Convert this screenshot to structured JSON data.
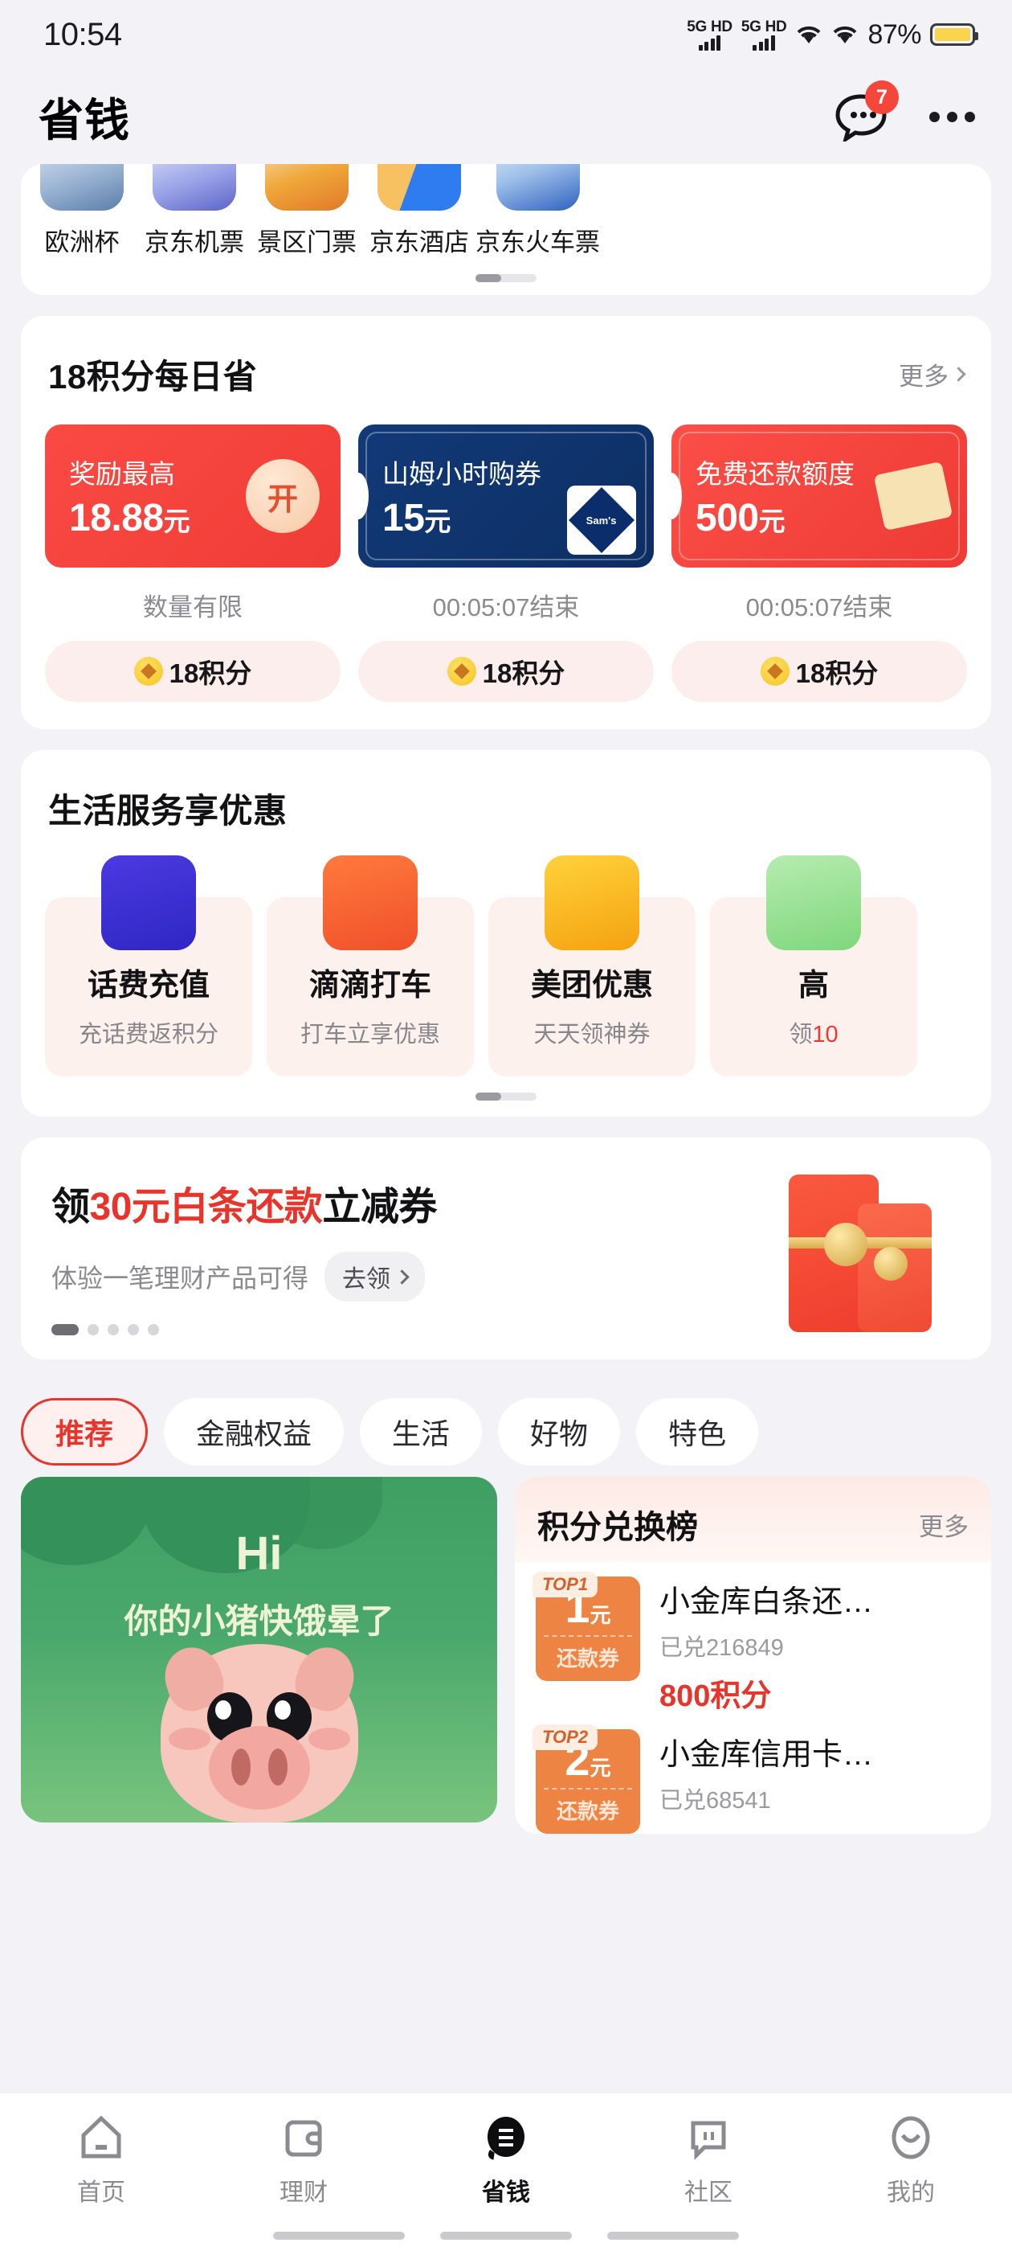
{
  "status_bar": {
    "time": "10:54",
    "network_1": "5G HD",
    "network_2": "5G HD",
    "battery_percent": "87%",
    "wifi_icon": "wifi-icon",
    "battery_icon": "battery-icon"
  },
  "header": {
    "title": "省钱",
    "chat_icon": "chat-bubble-icon",
    "chat_badge": "7",
    "more_icon": "more-options-icon"
  },
  "icon_row": {
    "items": [
      {
        "label": "欧洲杯"
      },
      {
        "label": "京东机票"
      },
      {
        "label": "景区门票"
      },
      {
        "label": "京东酒店"
      },
      {
        "label": "京东火车票"
      }
    ]
  },
  "daily_points": {
    "title": "18积分每日省",
    "more_label": "更多",
    "coupons": [
      {
        "line1": "奖励最高",
        "amount": "18.88",
        "unit": "元",
        "badge": "开",
        "sub": "数量有限",
        "pill": "18积分",
        "style": "red"
      },
      {
        "line1": "山姆小时购券",
        "amount": "15",
        "unit": "元",
        "badge": "Sam's CLUB",
        "sub": "00:05:07结束",
        "pill": "18积分",
        "style": "blue"
      },
      {
        "line1": "免费还款额度",
        "amount": "500",
        "unit": "元",
        "badge": "",
        "sub": "00:05:07结束",
        "pill": "18积分",
        "style": "red2"
      }
    ]
  },
  "life_services": {
    "title": "生活服务享优惠",
    "items": [
      {
        "title": "话费充值",
        "sub": "充话费返积分",
        "sub_highlight": "",
        "icon": "phone-recharge-icon"
      },
      {
        "title": "滴滴打车",
        "sub": "打车立享优惠",
        "sub_highlight": "",
        "icon": "taxi-icon"
      },
      {
        "title": "美团优惠",
        "sub": "天天领神券",
        "sub_highlight": "",
        "icon": "burger-icon"
      },
      {
        "title": "高",
        "sub": "领",
        "sub_highlight": "10",
        "icon": "green-card-icon"
      }
    ]
  },
  "promo_banner": {
    "title_pre": "领",
    "title_red": "30元白条还款",
    "title_post": "立减券",
    "sub": "体验一笔理财产品可得",
    "cta": "去领",
    "dots_total": 5,
    "dots_active": 0,
    "art": "red-envelope-icon"
  },
  "tabs": {
    "items": [
      {
        "label": "推荐",
        "active": true
      },
      {
        "label": "金融权益",
        "active": false
      },
      {
        "label": "生活",
        "active": false
      },
      {
        "label": "好物",
        "active": false
      },
      {
        "label": "特色",
        "active": false
      }
    ]
  },
  "feed": {
    "pig_card": {
      "greeting": "Hi",
      "message": "你的小猪快饿晕了"
    },
    "rank_card": {
      "title": "积分兑换榜",
      "more_label": "更多",
      "items": [
        {
          "rank": "TOP1",
          "amount": "1",
          "unit": "元",
          "tag": "还款券",
          "name": "小金库白条还…",
          "redeemed": "已兑216849",
          "points": "800积分"
        },
        {
          "rank": "TOP2",
          "amount": "2",
          "unit": "元",
          "tag": "还款券",
          "name": "小金库信用卡…",
          "redeemed": "已兑68541",
          "points": ""
        }
      ]
    }
  },
  "bottom_nav": {
    "items": [
      {
        "label": "首页",
        "icon": "home-icon",
        "active": false
      },
      {
        "label": "理财",
        "icon": "wallet-icon",
        "active": false
      },
      {
        "label": "省钱",
        "icon": "save-money-icon",
        "active": true
      },
      {
        "label": "社区",
        "icon": "community-icon",
        "active": false
      },
      {
        "label": "我的",
        "icon": "profile-icon",
        "active": false
      }
    ]
  },
  "colors": {
    "accent_red": "#e8352b",
    "badge_red": "#f5463b",
    "page_bg": "#f2f2f7",
    "card_bg": "#ffffff",
    "orange": "#ee8444",
    "green": "#4aa86c"
  }
}
